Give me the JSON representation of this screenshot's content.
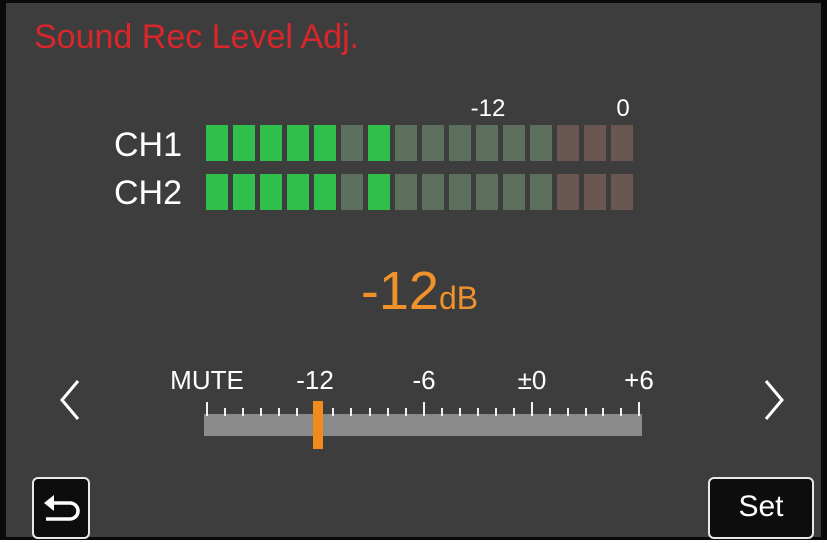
{
  "screen": {
    "title": "Sound Rec Level Adj.",
    "colors": {
      "background": "#3d3d3d",
      "title": "#d9262b",
      "accent": "#f0922a",
      "meter_green_on": "#2fbf4a",
      "meter_green_off": "#5c6e5c",
      "meter_red_off": "#6b5752"
    }
  },
  "meter": {
    "scale_labels": [
      "-12",
      "0"
    ],
    "segments_per_channel": 16,
    "channels": [
      {
        "label": "CH1",
        "lit_segments": [
          0,
          1,
          2,
          3,
          4,
          6
        ]
      },
      {
        "label": "CH2",
        "lit_segments": [
          0,
          1,
          2,
          3,
          4,
          6
        ]
      }
    ]
  },
  "level": {
    "value": "-12",
    "unit": "dB"
  },
  "slider": {
    "labels": [
      "MUTE",
      "-12",
      "-6",
      "±0",
      "+6"
    ],
    "current_label": "-12"
  },
  "icons": {
    "prev": "chevron-left-icon",
    "next": "chevron-right-icon",
    "back": "return-arrow-icon"
  },
  "buttons": {
    "set_label": "Set"
  }
}
